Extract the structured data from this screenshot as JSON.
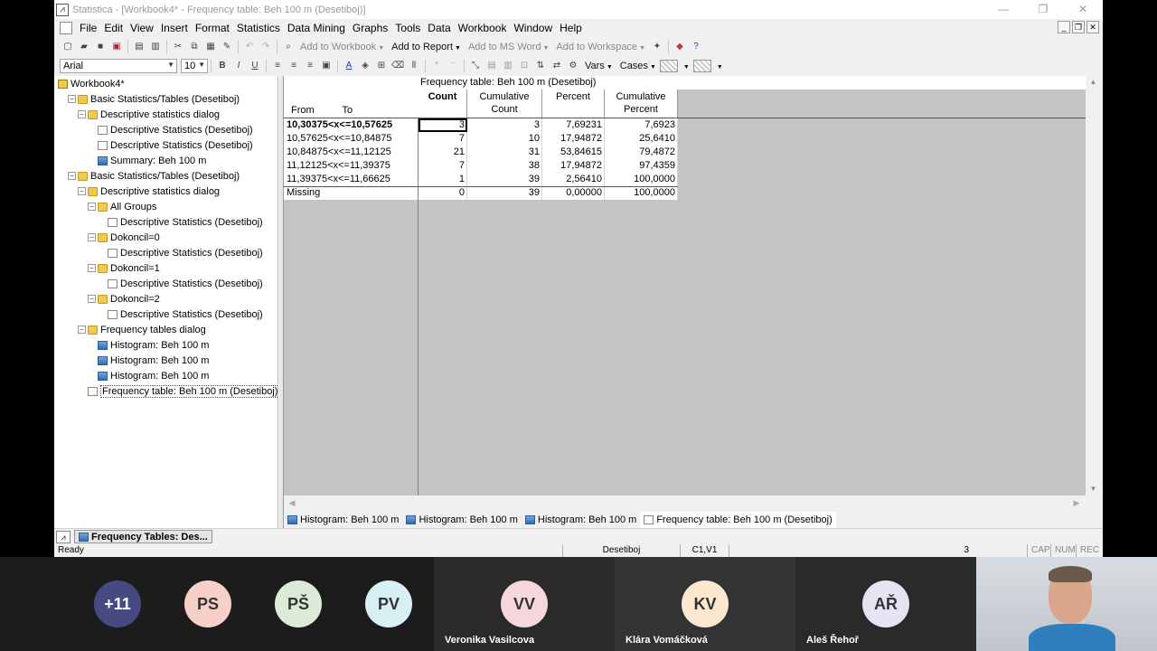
{
  "window": {
    "title": "Statistica - [Workbook4* - Frequency table: Beh 100 m (Desetiboj)]",
    "app_icon": "statistica-icon",
    "controls": [
      "—",
      "❐",
      "✕"
    ]
  },
  "menu": [
    "File",
    "Edit",
    "View",
    "Insert",
    "Format",
    "Statistics",
    "Data Mining",
    "Graphs",
    "Tools",
    "Data",
    "Workbook",
    "Window",
    "Help"
  ],
  "toolbar1": {
    "add_to_workbook": "Add to Workbook",
    "add_to_report": "Add to Report",
    "add_to_ms_word": "Add to MS Word",
    "add_to_workspace": "Add to Workspace"
  },
  "toolbar2": {
    "font": "Arial",
    "font_size": "10",
    "bold": "B",
    "italic": "I",
    "underline": "U",
    "vars": "Vars",
    "cases": "Cases"
  },
  "tree": [
    {
      "label": "Workbook4*",
      "level": 0,
      "icon": "workbook",
      "toggle": ""
    },
    {
      "label": "Basic Statistics/Tables (Desetiboj)",
      "level": 1,
      "icon": "folder",
      "toggle": "−"
    },
    {
      "label": "Descriptive statistics dialog",
      "level": 2,
      "icon": "folder",
      "toggle": "−"
    },
    {
      "label": "Descriptive Statistics (Desetiboj)",
      "level": 3,
      "icon": "page",
      "toggle": ""
    },
    {
      "label": "Descriptive Statistics (Desetiboj)",
      "level": 3,
      "icon": "page",
      "toggle": ""
    },
    {
      "label": "Summary: Beh 100 m",
      "level": 3,
      "icon": "graph",
      "toggle": ""
    },
    {
      "label": "Basic Statistics/Tables (Desetiboj)",
      "level": 1,
      "icon": "folder",
      "toggle": "−"
    },
    {
      "label": "Descriptive statistics dialog",
      "level": 2,
      "icon": "folder",
      "toggle": "−"
    },
    {
      "label": "All Groups",
      "level": 3,
      "icon": "folder",
      "toggle": "−"
    },
    {
      "label": "Descriptive Statistics (Desetiboj)",
      "level": 4,
      "icon": "page",
      "toggle": ""
    },
    {
      "label": "Dokoncil=0",
      "level": 3,
      "icon": "folder",
      "toggle": "−"
    },
    {
      "label": "Descriptive Statistics (Desetiboj)",
      "level": 4,
      "icon": "page",
      "toggle": ""
    },
    {
      "label": "Dokoncil=1",
      "level": 3,
      "icon": "folder",
      "toggle": "−"
    },
    {
      "label": "Descriptive Statistics (Desetiboj)",
      "level": 4,
      "icon": "page",
      "toggle": ""
    },
    {
      "label": "Dokoncil=2",
      "level": 3,
      "icon": "folder",
      "toggle": "−"
    },
    {
      "label": "Descriptive Statistics (Desetiboj)",
      "level": 4,
      "icon": "page",
      "toggle": ""
    },
    {
      "label": "Frequency tables dialog",
      "level": 2,
      "icon": "folder",
      "toggle": "−"
    },
    {
      "label": "Histogram: Beh 100 m",
      "level": 3,
      "icon": "graph",
      "toggle": ""
    },
    {
      "label": "Histogram: Beh 100 m",
      "level": 3,
      "icon": "graph",
      "toggle": ""
    },
    {
      "label": "Histogram: Beh 100 m",
      "level": 3,
      "icon": "graph",
      "toggle": ""
    },
    {
      "label": "Frequency table: Beh 100 m (Desetiboj)",
      "level": 3,
      "icon": "page",
      "toggle": "",
      "selected": true
    }
  ],
  "table": {
    "title": "Frequency table: Beh 100 m (Desetiboj)",
    "from_label": "From",
    "to_label": "To",
    "columns": [
      "Count",
      "Cumulative Count",
      "Percent",
      "Cumulative Percent"
    ],
    "columns_line1": [
      "Count",
      "Cumulative",
      "Percent",
      "Cumulative"
    ],
    "columns_line2": [
      "",
      "Count",
      "",
      "Percent"
    ],
    "rows": [
      {
        "label": "10,30375<x<=10,57625",
        "values": [
          "3",
          "3",
          "7,69231",
          "7,6923"
        ],
        "bold": true
      },
      {
        "label": "10,57625<x<=10,84875",
        "values": [
          "7",
          "10",
          "17,94872",
          "25,6410"
        ]
      },
      {
        "label": "10,84875<x<=11,12125",
        "values": [
          "21",
          "31",
          "53,84615",
          "79,4872"
        ]
      },
      {
        "label": "11,12125<x<=11,39375",
        "values": [
          "7",
          "38",
          "17,94872",
          "97,4359"
        ]
      },
      {
        "label": "11,39375<x<=11,66625",
        "values": [
          "1",
          "39",
          "2,56410",
          "100,0000"
        ]
      },
      {
        "label": "Missing",
        "values": [
          "0",
          "39",
          "0,00000",
          "100,0000"
        ]
      }
    ]
  },
  "doc_tabs": [
    {
      "label": "Histogram: Beh 100 m",
      "icon": "graph"
    },
    {
      "label": "Histogram: Beh 100 m",
      "icon": "graph"
    },
    {
      "label": "Histogram: Beh 100 m",
      "icon": "graph"
    },
    {
      "label": "Frequency table: Beh 100 m (Desetiboj)",
      "icon": "page",
      "active": true
    }
  ],
  "mdi_tab": "Frequency Tables: Des...",
  "status": {
    "ready": "Ready",
    "dataset": "Desetiboj",
    "cell": "C1,V1",
    "value": "3",
    "cap": "CAP",
    "num": "NUM",
    "rec": "REC"
  },
  "participants": [
    {
      "initials": "+11",
      "name": "",
      "color": "#474a82",
      "text_color": "#ffffff"
    },
    {
      "initials": "PS",
      "name": "",
      "color": "#f5cfc8"
    },
    {
      "initials": "PŠ",
      "name": "",
      "color": "#dcebd8"
    },
    {
      "initials": "PV",
      "name": "",
      "color": "#d8f0f4"
    },
    {
      "initials": "VV",
      "name": "Veronika Vasilcova",
      "color": "#f5d7dc"
    },
    {
      "initials": "KV",
      "name": "Klára Vomáčková",
      "color": "#fbe8cf"
    },
    {
      "initials": "AŘ",
      "name": "Aleš Řehoř",
      "color": "#e6e4f2"
    }
  ]
}
